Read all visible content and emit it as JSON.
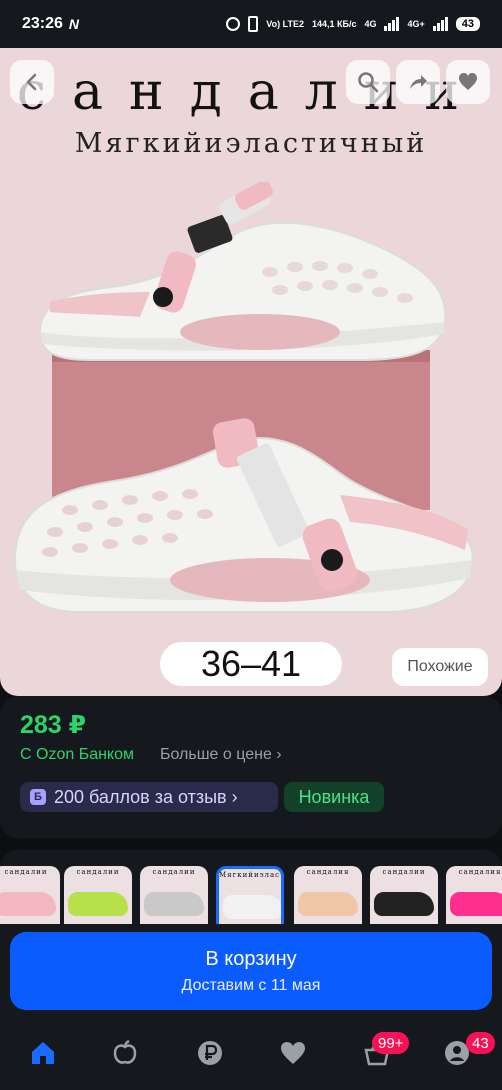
{
  "status_bar": {
    "time": "23:26",
    "n_icon": "N",
    "volte": "Vo) LTE2",
    "speed": "144,1 КБ/с",
    "net1": "4G",
    "net2": "4G+",
    "battery": "43"
  },
  "product_image": {
    "title_text": "сандалии",
    "subtitle_text": "Мягкийиэластичный",
    "size_text": "36–41",
    "similar_label": "Похожие"
  },
  "icons": {
    "back": "back-chevron-icon",
    "search": "search-icon",
    "share": "share-icon",
    "favorite": "heart-icon"
  },
  "product_info": {
    "price": "283 ₽",
    "ozon_bank": "С Ozon Банком",
    "more_price": "Больше о цене ›",
    "points_icon": "Б",
    "points_chip": "200 баллов за отзыв ›",
    "new_chip": "Новинка"
  },
  "thumbnails": [
    {
      "title": "сандалии",
      "color": "#f4b7c2"
    },
    {
      "title": "сандалии",
      "color": "#b8e04a"
    },
    {
      "title": "сандалии",
      "color": "#c9c9c9"
    },
    {
      "title": "Мягкийиэластичный",
      "color": "#f1f1f1"
    },
    {
      "title": "сандалия",
      "color": "#f0c7a6"
    },
    {
      "title": "сандалии",
      "color": "#222222"
    },
    {
      "title": "сандалия",
      "color": "#ff2f8f"
    }
  ],
  "cart": {
    "title": "В корзину",
    "subtitle": "Доставим с 11 мая"
  },
  "bottom_nav": {
    "cart_badge": "99+",
    "profile_badge": "43"
  },
  "colors": {
    "accent_blue": "#0a5cff",
    "price_green": "#2fd36b",
    "badge_pink": "#f91155"
  }
}
